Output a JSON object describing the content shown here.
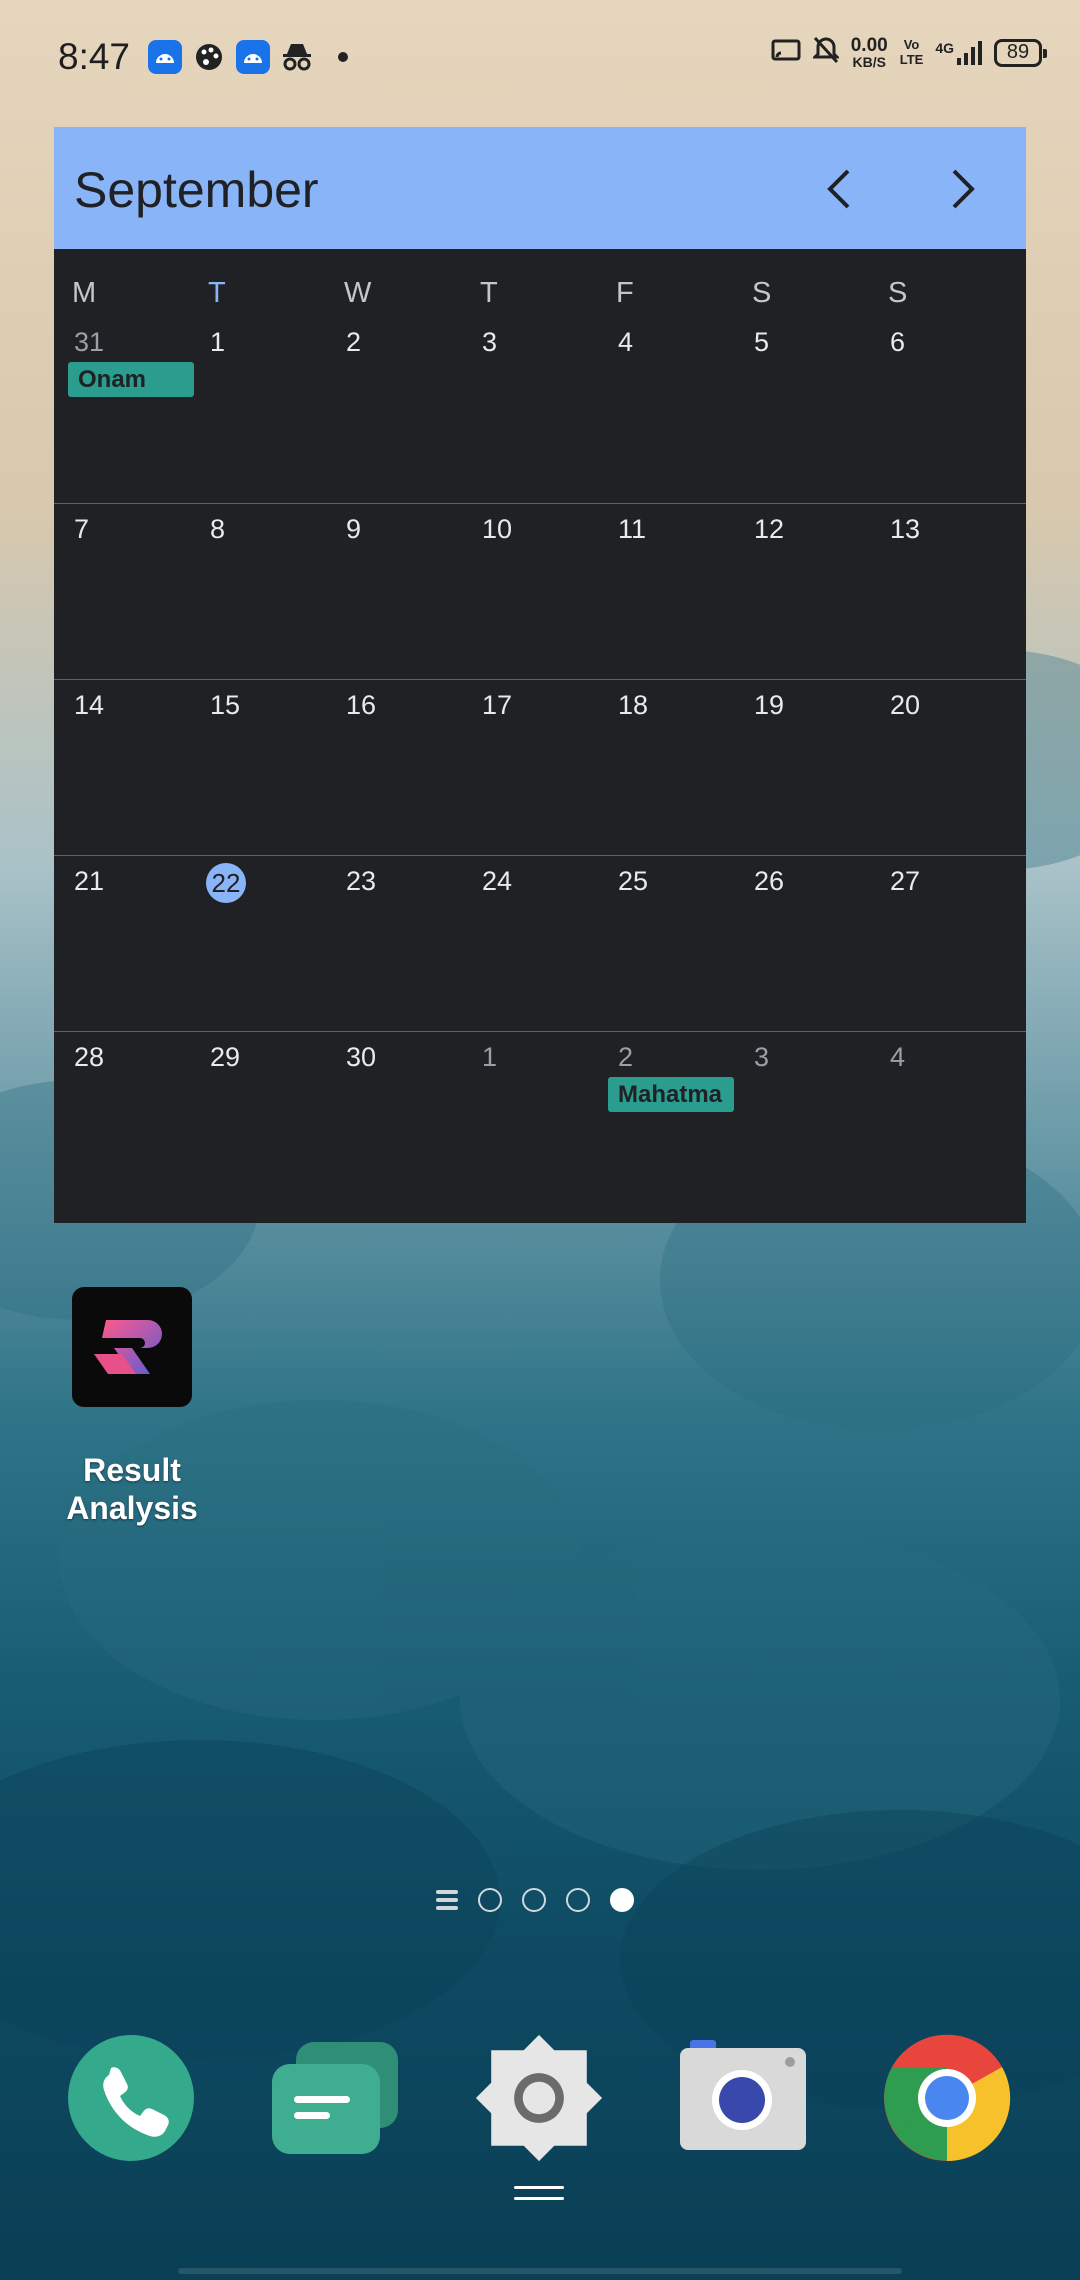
{
  "status_bar": {
    "time": "8:47",
    "notification_icons": [
      "android-icon",
      "palette-icon",
      "android-icon",
      "incognito-icon"
    ],
    "net_speed_value": "0.00",
    "net_speed_unit": "KB/S",
    "volte_line1": "Vo",
    "volte_line2": "LTE",
    "network": "4G",
    "battery": "89"
  },
  "calendar": {
    "month": "September",
    "weekdays": [
      "M",
      "T",
      "W",
      "T",
      "F",
      "S",
      "S"
    ],
    "today_weekday_index": 1,
    "today": "22",
    "weeks": [
      [
        "31",
        "1",
        "2",
        "3",
        "4",
        "5",
        "6"
      ],
      [
        "7",
        "8",
        "9",
        "10",
        "11",
        "12",
        "13"
      ],
      [
        "14",
        "15",
        "16",
        "17",
        "18",
        "19",
        "20"
      ],
      [
        "21",
        "22",
        "23",
        "24",
        "25",
        "26",
        "27"
      ],
      [
        "28",
        "29",
        "30",
        "1",
        "2",
        "3",
        "4"
      ]
    ],
    "events": [
      {
        "week": 0,
        "day": 0,
        "label": "Onam"
      },
      {
        "week": 4,
        "day": 4,
        "label": "Mahatma"
      }
    ],
    "colors": {
      "header": "#8ab4f8",
      "body": "#202124",
      "event": "#2a9d8f",
      "today": "#8ab4f8"
    }
  },
  "app_shortcut": {
    "label_line1": "Result",
    "label_line2": "Analysis"
  },
  "pager": {
    "pages": 4,
    "active_index": 3
  },
  "dock": {
    "apps": [
      "phone-icon",
      "messages-icon",
      "settings-icon",
      "camera-icon",
      "chrome-icon"
    ]
  }
}
